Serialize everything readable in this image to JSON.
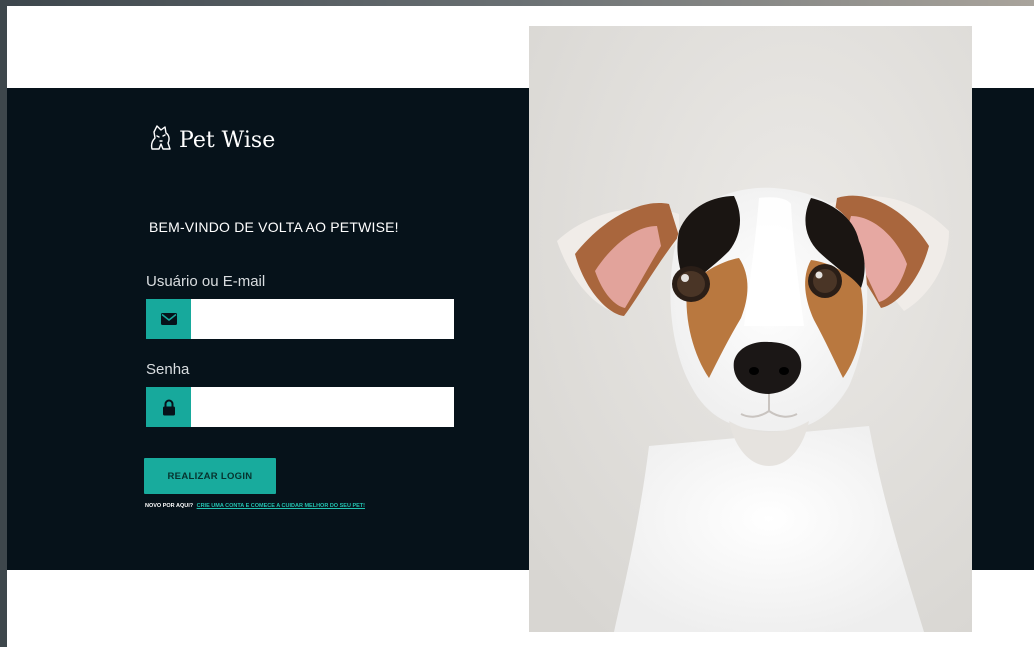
{
  "brand": {
    "name": "Pet Wise"
  },
  "login": {
    "welcome": "BEM-VINDO DE VOLTA AO PETWISE!",
    "username_label": "Usuário ou E-mail",
    "username_value": "",
    "password_label": "Senha",
    "password_value": "",
    "submit_label": "REALIZAR LOGIN",
    "signup_prompt": "NOVO POR AQUI?",
    "signup_link": "CRIE UMA CONTA E COMECE A CUIDAR MELHOR DO SEU PET!"
  },
  "icons": {
    "logo": "pet-logo-icon",
    "username": "envelope-icon",
    "password": "lock-icon"
  },
  "colors": {
    "accent": "#17a99c",
    "band": "#06121a",
    "photo_background": "#e4e2de"
  }
}
